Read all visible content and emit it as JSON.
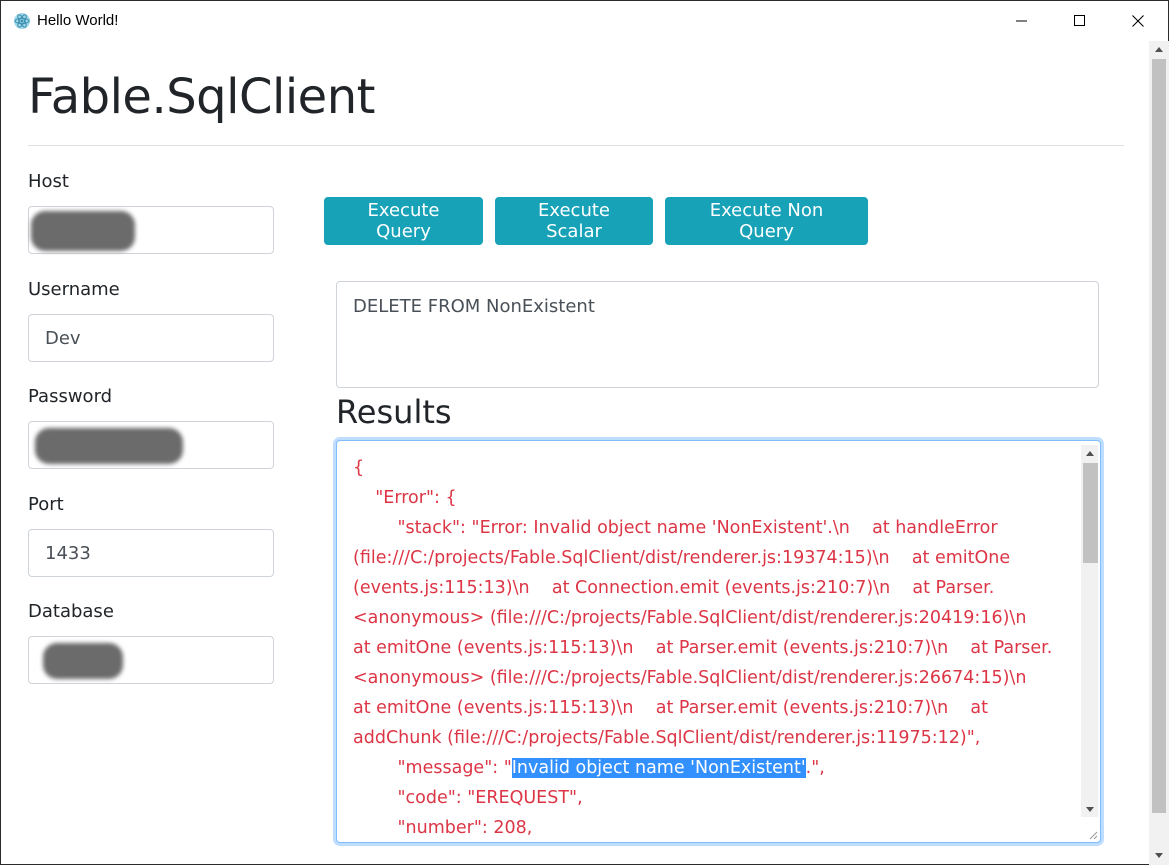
{
  "window": {
    "title": "Hello World!"
  },
  "page": {
    "title": "Fable.SqlClient"
  },
  "form": {
    "host": {
      "label": "Host",
      "value": ""
    },
    "username": {
      "label": "Username",
      "value": "Dev"
    },
    "password": {
      "label": "Password",
      "value": ""
    },
    "port": {
      "label": "Port",
      "value": "1433"
    },
    "database": {
      "label": "Database",
      "value": ""
    }
  },
  "actions": {
    "execute_query": "Execute Query",
    "execute_scalar": "Execute Scalar",
    "execute_non_query": "Execute Non Query"
  },
  "query": {
    "text": "DELETE FROM NonExistent"
  },
  "results": {
    "heading": "Results",
    "lines": [
      "{",
      "    \"Error\": {",
      "        \"stack\": \"Error: Invalid object name 'NonExistent'.\\n    at handleError",
      "(file:///C:/projects/Fable.SqlClient/dist/renderer.js:19374:15)\\n    at emitOne",
      "(events.js:115:13)\\n    at Connection.emit (events.js:210:7)\\n    at Parser.",
      "<anonymous> (file:///C:/projects/Fable.SqlClient/dist/renderer.js:20419:16)\\n",
      "at emitOne (events.js:115:13)\\n    at Parser.emit (events.js:210:7)\\n    at Parser.",
      "<anonymous> (file:///C:/projects/Fable.SqlClient/dist/renderer.js:26674:15)\\n",
      "at emitOne (events.js:115:13)\\n    at Parser.emit (events.js:210:7)\\n    at",
      "addChunk (file:///C:/projects/Fable.SqlClient/dist/renderer.js:11975:12)\","
    ],
    "message_prefix": "        \"message\": \"",
    "message_selected": "Invalid object name 'NonExistent'",
    "message_suffix": ".\",",
    "tail_lines": [
      "        \"code\": \"EREQUEST\",",
      "        \"number\": 208,"
    ]
  },
  "colors": {
    "accent": "#17a2b8",
    "error_text": "#dc3545",
    "selection": "#3390ff"
  },
  "icons": {
    "app": "electron-atom-icon",
    "minimize": "minimize-icon",
    "maximize": "maximize-icon",
    "close": "close-icon"
  }
}
